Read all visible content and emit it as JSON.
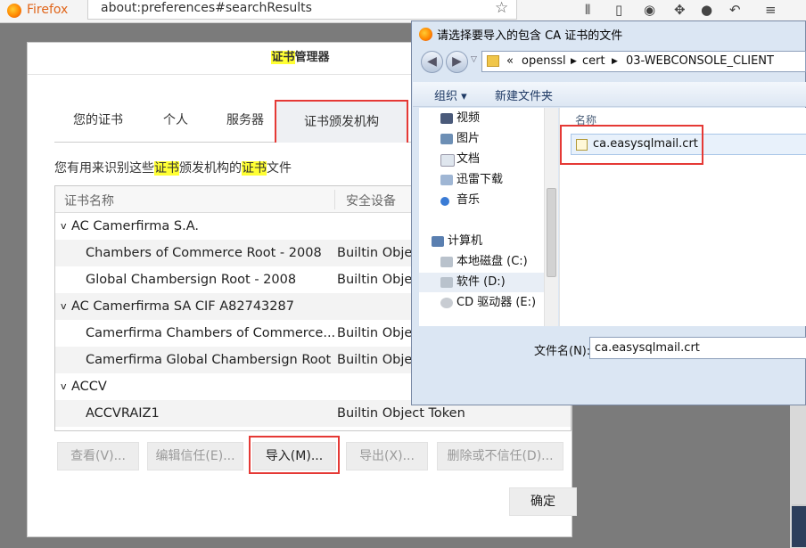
{
  "browser": {
    "name": "Firefox",
    "url": "about:preferences#searchResults"
  },
  "cert_manager": {
    "title_hl": "证书",
    "title_rest": "管理器",
    "tabs": [
      "您的证书",
      "个人",
      "服务器",
      "证书颁发机构"
    ],
    "desc_parts": [
      "您有用来识别这些",
      "证书",
      "颁发机构的",
      "证书",
      "文件"
    ],
    "columns": [
      "证书名称",
      "安全设备"
    ],
    "rows": [
      {
        "group": true,
        "name": "AC Camerfirma S.A.",
        "token": ""
      },
      {
        "group": false,
        "name": "Chambers of Commerce Root - 2008",
        "token": "Builtin Obje"
      },
      {
        "group": false,
        "name": "Global Chambersign Root - 2008",
        "token": "Builtin Obje"
      },
      {
        "group": true,
        "name": "AC Camerfirma SA CIF A82743287",
        "token": ""
      },
      {
        "group": false,
        "name": "Camerfirma Chambers of Commerce...",
        "token": "Builtin Obje"
      },
      {
        "group": false,
        "name": "Camerfirma Global Chambersign Root",
        "token": "Builtin Obje"
      },
      {
        "group": true,
        "name": "ACCV",
        "token": ""
      },
      {
        "group": false,
        "name": "ACCVRAIZ1",
        "token": "Builtin Object Token"
      }
    ],
    "buttons": {
      "view": "查看(V)...",
      "edit_trust": "编辑信任(E)...",
      "import": "导入(M)...",
      "export": "导出(X)...",
      "delete": "删除或不信任(D)...",
      "ok": "确定"
    }
  },
  "file_dialog": {
    "title": "请选择要导入的包含 CA 证书的文件",
    "path": [
      "«",
      "openssl",
      "cert",
      "03-WEBCONSOLE_CLIENT"
    ],
    "toolbar": {
      "organize": "组织 ▾",
      "new_folder": "新建文件夹"
    },
    "nav": [
      {
        "label": "视频",
        "icon": "video-icon"
      },
      {
        "label": "图片",
        "icon": "pictures-icon"
      },
      {
        "label": "文档",
        "icon": "documents-icon"
      },
      {
        "label": "迅雷下载",
        "icon": "download-folder-icon"
      },
      {
        "label": "音乐",
        "icon": "music-icon"
      },
      {
        "label": "计算机",
        "icon": "computer-icon"
      },
      {
        "label": "本地磁盘 (C:)",
        "icon": "drive-icon"
      },
      {
        "label": "软件 (D:)",
        "icon": "drive-icon"
      },
      {
        "label": "CD 驱动器 (E:)",
        "icon": "cd-drive-icon"
      }
    ],
    "files_header": "名称",
    "file": "ca.easysqlmail.crt",
    "filename_label": "文件名(N):",
    "filename_value": "ca.easysqlmail.crt"
  },
  "colors": {
    "highlight": "#ffff33",
    "annotation": "#e53935"
  }
}
